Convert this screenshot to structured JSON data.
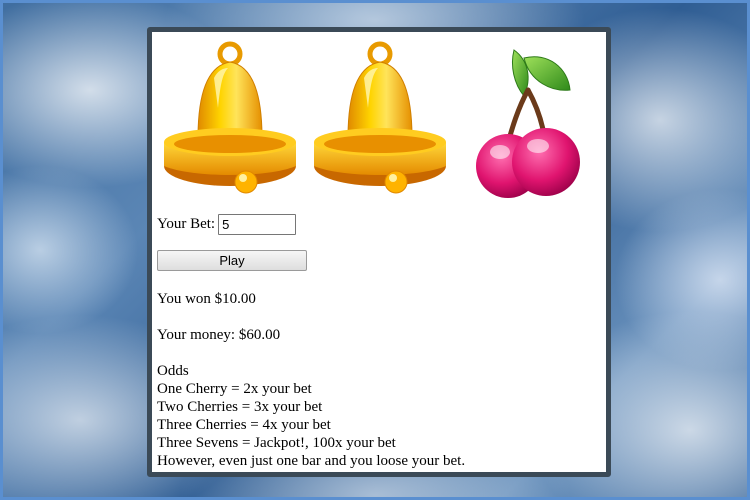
{
  "reels": [
    {
      "symbol": "bell-icon"
    },
    {
      "symbol": "bell-icon"
    },
    {
      "symbol": "cherry-icon"
    }
  ],
  "bet": {
    "label": "Your Bet:",
    "value": "5"
  },
  "play_label": "Play",
  "result_text": "You won $10.00",
  "money_text": "Your money: $60.00",
  "odds": {
    "title": "Odds",
    "lines": [
      "One Cherry = 2x your bet",
      "Two Cherries = 3x your bet",
      "Three Cherries = 4x your bet",
      "Three Sevens = Jackpot!, 100x your bet",
      "However, even just one bar and you loose your bet."
    ]
  },
  "colors": {
    "panel_border": "#3b4a57",
    "bell": "#f7b500",
    "cherry": "#e0146f"
  }
}
